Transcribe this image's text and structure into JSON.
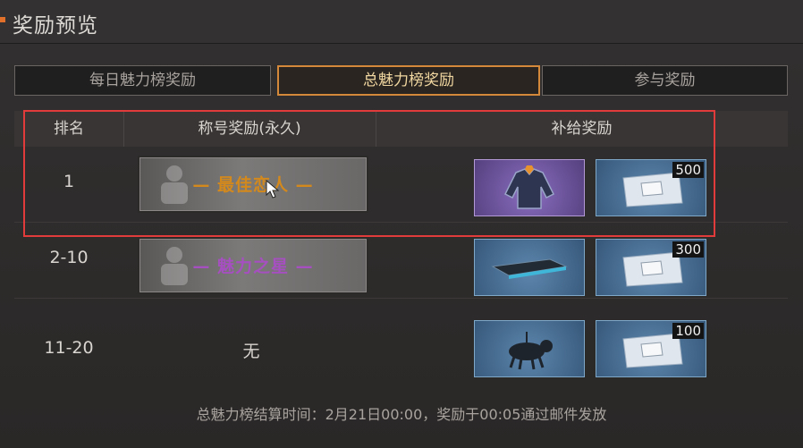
{
  "header": {
    "title": "奖励预览"
  },
  "tabs": [
    {
      "label": "每日魅力榜奖励"
    },
    {
      "label": "总魅力榜奖励",
      "active": true
    },
    {
      "label": "参与奖励"
    }
  ],
  "table": {
    "headers": {
      "rank": "排名",
      "title": "称号奖励(永久)",
      "supply": "补给奖励"
    },
    "rows": [
      {
        "rank": "1",
        "title": "— 最佳恋人 —",
        "title_color": "#d4891c",
        "items": [
          {
            "icon": "jacket-icon",
            "style": "purple",
            "count": ""
          },
          {
            "icon": "supply-pack-icon",
            "style": "blue",
            "count": "500"
          }
        ]
      },
      {
        "rank": "2-10",
        "title": "— 魅力之星 —",
        "title_color": "#a64fc0",
        "items": [
          {
            "icon": "hoverboard-icon",
            "style": "blue",
            "count": ""
          },
          {
            "icon": "supply-pack-icon",
            "style": "blue",
            "count": "300"
          }
        ]
      },
      {
        "rank": "11-20",
        "title": "无",
        "items": [
          {
            "icon": "mech-pet-icon",
            "style": "blue",
            "count": ""
          },
          {
            "icon": "supply-pack-icon",
            "style": "blue",
            "count": "100"
          }
        ]
      }
    ]
  },
  "footer": "总魅力榜结算时间：2月21日00:00，奖励于00:05通过邮件发放",
  "colors": {
    "accent": "#e0702a",
    "tab_active_border": "#d4883a",
    "highlight": "#e23b3b"
  }
}
